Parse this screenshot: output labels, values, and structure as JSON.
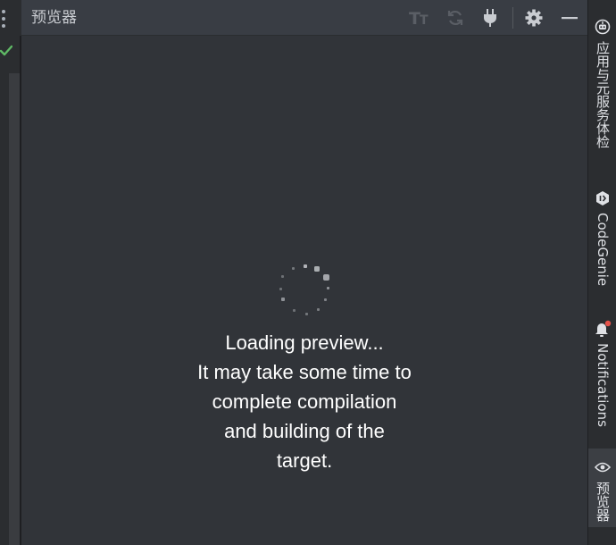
{
  "panel": {
    "title": "预览器"
  },
  "header_icons": [
    {
      "name": "font-size-icon",
      "glyph": "Tt"
    },
    {
      "name": "refresh-icon"
    },
    {
      "name": "plug-icon"
    },
    {
      "name": "gear-icon"
    },
    {
      "name": "minimize-icon"
    }
  ],
  "loading": {
    "line1": "Loading preview...",
    "line2": "It may take some time to",
    "line3": "complete compilation",
    "line4": "and building of the",
    "line5": "target."
  },
  "right_sidebar": {
    "items": [
      {
        "label": "应用与元服务体检",
        "icon": "robot-icon"
      },
      {
        "label": "CodeGenie",
        "icon": "codegenie-icon"
      },
      {
        "label": "Notifications",
        "icon": "bell-icon"
      },
      {
        "label": "预览器",
        "icon": "eye-icon",
        "active": true
      }
    ]
  },
  "colors": {
    "panel_bg": "#313439",
    "header_bg": "#393d44",
    "text": "#ffffff",
    "check": "#5fb865",
    "notification_dot": "#e5534b"
  }
}
